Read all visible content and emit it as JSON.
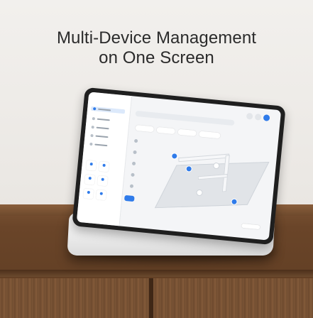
{
  "headline": {
    "line1": "Multi-Device Management",
    "line2": "on One Screen"
  },
  "colors": {
    "accent": "#2f7bea",
    "wood": "#6a4529",
    "wall": "#ebe8e4",
    "headline_text": "#2b2b2b"
  },
  "icons": [
    "device-pin-icon",
    "sidebar-dot-icon",
    "toolbar-circle-icon"
  ]
}
